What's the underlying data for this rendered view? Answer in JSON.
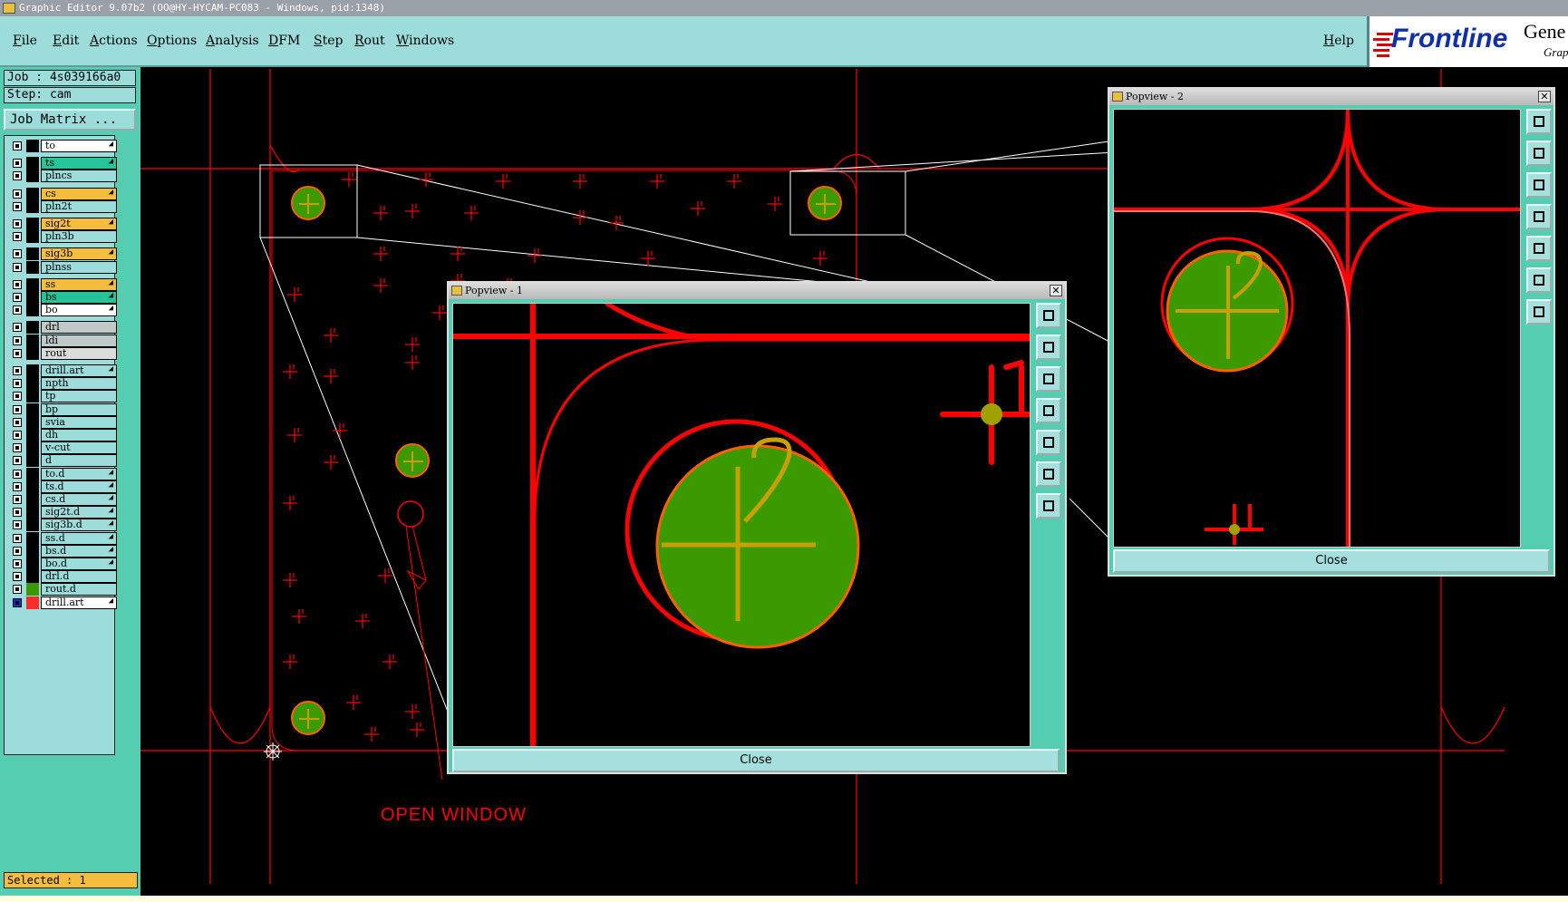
{
  "window": {
    "title": "Graphic Editor 9.07b2 (OO@HY-HYCAM-PC083 - Windows, pid:1348)"
  },
  "menu": {
    "items": [
      "File",
      "Edit",
      "Actions",
      "Options",
      "Analysis",
      "DFM",
      "Step",
      "Rout",
      "Windows"
    ],
    "help": "Help"
  },
  "logo": {
    "text": "Frontline",
    "side_text": "Gene",
    "side_sub": "Grap"
  },
  "job": {
    "job_label": "Job : 4s039166a0",
    "step_label": "Step: cam",
    "matrix_button": "Job Matrix ..."
  },
  "layers": [
    {
      "name": "to",
      "color": "#ffffff",
      "arrow": true
    },
    {
      "name": "ts",
      "color": "#26c49a",
      "arrow": true
    },
    {
      "name": "plncs",
      "color": "#9cdcda",
      "arrow": false
    },
    {
      "name": "cs",
      "color": "#f5bd3d",
      "arrow": true
    },
    {
      "name": "pln2t",
      "color": "#9cdcda",
      "arrow": false
    },
    {
      "name": "sig2t",
      "color": "#f5bd3d",
      "arrow": true
    },
    {
      "name": "pln3b",
      "color": "#9cdcda",
      "arrow": false
    },
    {
      "name": "sig3b",
      "color": "#f5bd3d",
      "arrow": true
    },
    {
      "name": "plnss",
      "color": "#9cdcda",
      "arrow": false
    },
    {
      "name": "ss",
      "color": "#f5bd3d",
      "arrow": true
    },
    {
      "name": "bs",
      "color": "#26c49a",
      "arrow": true
    },
    {
      "name": "bo",
      "color": "#ffffff",
      "arrow": true
    },
    {
      "name": "drl",
      "color": "#c0c8c8",
      "arrow": false
    },
    {
      "name": "ldi",
      "color": "#c0c8c8",
      "arrow": false
    },
    {
      "name": "rout",
      "color": "#dcdcdc",
      "arrow": false
    },
    {
      "name": "drill.art",
      "color": "#9cdcda",
      "arrow": true
    },
    {
      "name": "npth",
      "color": "#9cdcda",
      "arrow": false
    },
    {
      "name": "tp",
      "color": "#9cdcda",
      "arrow": false
    },
    {
      "name": "bp",
      "color": "#9cdcda",
      "arrow": false
    },
    {
      "name": "svia",
      "color": "#9cdcda",
      "arrow": false
    },
    {
      "name": "dh",
      "color": "#9cdcda",
      "arrow": false
    },
    {
      "name": "v-cut",
      "color": "#9cdcda",
      "arrow": false
    },
    {
      "name": "d",
      "color": "#9cdcda",
      "arrow": false
    },
    {
      "name": "to.d",
      "color": "#9cdcda",
      "arrow": true
    },
    {
      "name": "ts.d",
      "color": "#9cdcda",
      "arrow": true
    },
    {
      "name": "cs.d",
      "color": "#9cdcda",
      "arrow": true
    },
    {
      "name": "sig2t.d",
      "color": "#9cdcda",
      "arrow": true
    },
    {
      "name": "sig3b.d",
      "color": "#9cdcda",
      "arrow": true
    },
    {
      "name": "ss.d",
      "color": "#9cdcda",
      "arrow": true
    },
    {
      "name": "bs.d",
      "color": "#9cdcda",
      "arrow": true
    },
    {
      "name": "bo.d",
      "color": "#9cdcda",
      "arrow": true
    },
    {
      "name": "drl.d",
      "color": "#9cdcda",
      "arrow": false
    },
    {
      "name": "rout.d",
      "color": "#9cdcda",
      "arrow": false
    },
    {
      "name": "drill.art",
      "color": "#ffffff",
      "arrow": true
    }
  ],
  "status": {
    "selected": "Selected : 1"
  },
  "annotation": {
    "text": "OPEN WINDOW"
  },
  "popview1": {
    "title": "Popview - 1",
    "close_label": "Close",
    "close_x": "✕"
  },
  "popview2": {
    "title": "Popview - 2",
    "close_label": "Close",
    "close_x": "✕"
  },
  "colors": {
    "panel": "#55cdb0",
    "menubar": "#9cdcda",
    "copper": "#ff0000",
    "pad": "#3a9a00",
    "highlight": "#f5bd3d"
  }
}
